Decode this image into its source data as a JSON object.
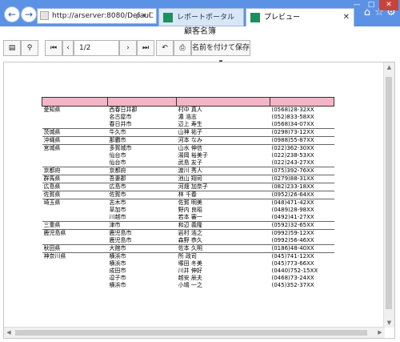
{
  "browser": {
    "url": "http://arserver:8080/Defaul",
    "url_controls": "ρ ▾ C",
    "tabs": [
      {
        "label": "レポートポータル",
        "active": false
      },
      {
        "label": "プレビュー",
        "active": true
      }
    ],
    "back_glyph": "←",
    "forward_glyph": "→",
    "right_icons": [
      "home-icon",
      "star-icon",
      "gear-icon"
    ]
  },
  "window_controls": {
    "minimize": "—",
    "maximize": "□",
    "close": "✕"
  },
  "page": {
    "title": "顧客名簿"
  },
  "toolbar": {
    "page_indicator": "1/2",
    "save_as_label": "名前を付けて保存▾"
  },
  "report": {
    "headers": [
      "",
      "",
      "",
      ""
    ],
    "groups": [
      {
        "pref": "愛知県",
        "rows": [
          [
            "西春日井郡",
            "村中 真人",
            "(0568)28-32XX"
          ],
          [
            "名古屋市",
            "濃 浩志",
            "(052)833-58XX"
          ],
          [
            "春日井市",
            "辺上 寿生",
            "(0568)34-07XX"
          ]
        ]
      },
      {
        "pref": "茨城県",
        "rows": [
          [
            "牛久市",
            "山神 祐子",
            "(0298)73-12XX"
          ]
        ]
      },
      {
        "pref": "沖縄県",
        "rows": [
          [
            "那覇市",
            "河本 なみ",
            "(0988)55-87XX"
          ]
        ]
      },
      {
        "pref": "宮城県",
        "rows": [
          [
            "多賀城市",
            "山水 伸信",
            "(022)362-30XX"
          ],
          [
            "仙台市",
            "湯岡 裕美子",
            "(022)238-53XX"
          ],
          [
            "仙台市",
            "武島 友子",
            "(022)243-27XX"
          ]
        ]
      },
      {
        "pref": "京都府",
        "rows": [
          [
            "京都府",
            "渡川 秀人",
            "(075)392-76XX"
          ]
        ]
      },
      {
        "pref": "群馬県",
        "rows": [
          [
            "吾妻郡",
            "池山 翔司",
            "(0279)88-31XX"
          ]
        ]
      },
      {
        "pref": "広島県",
        "rows": [
          [
            "広島市",
            "河畑 加奈子",
            "(082)233-18XX"
          ]
        ]
      },
      {
        "pref": "佐賀県",
        "rows": [
          [
            "佐賀市",
            "林 千春",
            "(0952)26-64XX"
          ]
        ]
      },
      {
        "pref": "埼玉県",
        "rows": [
          [
            "志木市",
            "佐賀 明美",
            "(048)471-42XX"
          ],
          [
            "草加市",
            "野内 良昭",
            "(0489)28-98XX"
          ],
          [
            "川越市",
            "若本 審一",
            "(0492)41-27XX"
          ]
        ]
      },
      {
        "pref": "三重県",
        "rows": [
          [
            "津市",
            "和辺 義隆",
            "(0592)32-65XX"
          ]
        ]
      },
      {
        "pref": "鹿児島県",
        "rows": [
          [
            "鹿児島市",
            "岩村 浩之",
            "(0992)59-12XX"
          ],
          [
            "鹿児島市",
            "森野 恭久",
            "(0992)56-46XX"
          ]
        ]
      },
      {
        "pref": "秋田県",
        "rows": [
          [
            "大館市",
            "佐本 久明",
            "(0186)48-40XX"
          ]
        ]
      },
      {
        "pref": "神奈川県",
        "rows": [
          [
            "横浜市",
            "所 政司",
            "(045)741-12XX"
          ],
          [
            "横浜市",
            "塚田 冬美",
            "(045)773-66XX"
          ],
          [
            "成田市",
            "川井 伸好",
            "(0440)752-15XX"
          ],
          [
            "逗子市",
            "越安 辰夫",
            "(0468)73-24XX"
          ],
          [
            "横浜市",
            "小鳩 一之",
            "(045)352-37XX"
          ]
        ]
      }
    ]
  }
}
